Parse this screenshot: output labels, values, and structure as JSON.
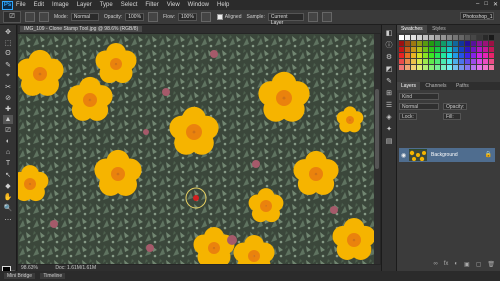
{
  "menubar": {
    "logo": "Ps",
    "items": [
      "File",
      "Edit",
      "Image",
      "Layer",
      "Type",
      "Select",
      "Filter",
      "View",
      "Window",
      "Help"
    ],
    "window_controls": [
      "–",
      "□",
      "✕"
    ]
  },
  "options": {
    "mode_label": "Mode:",
    "mode_value": "Normal",
    "opacity_label": "Opacity:",
    "opacity_value": "100%",
    "flow_label": "Flow:",
    "flow_value": "100%",
    "aligned_label": "Aligned",
    "sample_label": "Sample:",
    "sample_value": "Current Layer",
    "workspace_value": "Photoshop_1"
  },
  "document": {
    "tab_title": "IMG_109 - Clone Stamp Tool.jpg @ 98.6% (RGB/8)",
    "zoom": "98.63%",
    "doc_info": "Doc: 1.61M/1.61M"
  },
  "bottom_tabs": [
    "Mini Bridge",
    "Timeline"
  ],
  "tools": [
    "✥",
    "⬚",
    "ʘ",
    "✎",
    "⌖",
    "✂",
    "⊘",
    "✚",
    "▲",
    "⎚",
    "◐",
    "⌂",
    "T",
    "↖",
    "◆",
    "✋",
    "🔍",
    "⋯"
  ],
  "panel_icons": [
    "◧",
    "ⓘ",
    "⚙",
    "◩",
    "✎",
    "⊞",
    "☰",
    "◈",
    "✦",
    "▤"
  ],
  "color_panel": {
    "tabs": [
      "Swatches",
      "Styles"
    ]
  },
  "layers_panel": {
    "tabs": [
      "Layers",
      "Channels",
      "Paths"
    ],
    "kind_label": "Kind",
    "blend_mode": "Normal",
    "opacity_label": "Opacity:",
    "lock_label": "Lock:",
    "fill_label": "Fill:",
    "layer_name": "Background",
    "footer_icons": [
      "∞",
      "fx",
      "◐",
      "▣",
      "▢",
      "🗑"
    ]
  },
  "colors": {
    "accent": "#4f6d8f",
    "petal": "#f6b400",
    "flower_center": "#e97a10",
    "foliage": "#3d4a3d"
  }
}
